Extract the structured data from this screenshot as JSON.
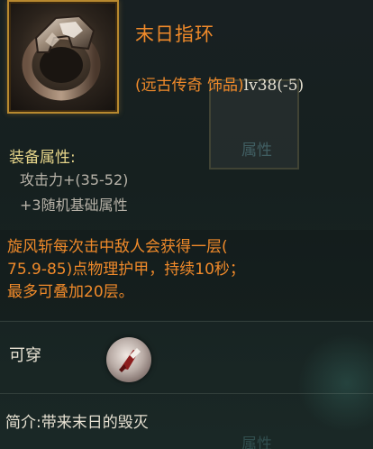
{
  "item": {
    "name": "末日指环",
    "type": "(远古传奇 饰品)",
    "level": "lv38(-5)",
    "icon": "ring-icon"
  },
  "attributes": {
    "title": "装备属性:",
    "stats": [
      "攻击力+(35-52)",
      "+3随机基础属性"
    ]
  },
  "effect": {
    "lines": [
      "旋风斩每次击中敌人会获得一层(",
      "75.9-85)点物理护甲，持续10秒；",
      "最多可叠加20层。"
    ]
  },
  "wearable": {
    "label": "可穿",
    "icon": "sword-slash-icon"
  },
  "intro": {
    "text": "简介:带来末日的毁灭"
  },
  "background": {
    "slot_label": "属性",
    "slot_label_2": "属性"
  },
  "colors": {
    "legendary_orange": "#f08a2a",
    "attribute_yellow": "#e6d58a",
    "stat_gray": "#b7b2a8",
    "frame_gold": "#b8892f"
  }
}
